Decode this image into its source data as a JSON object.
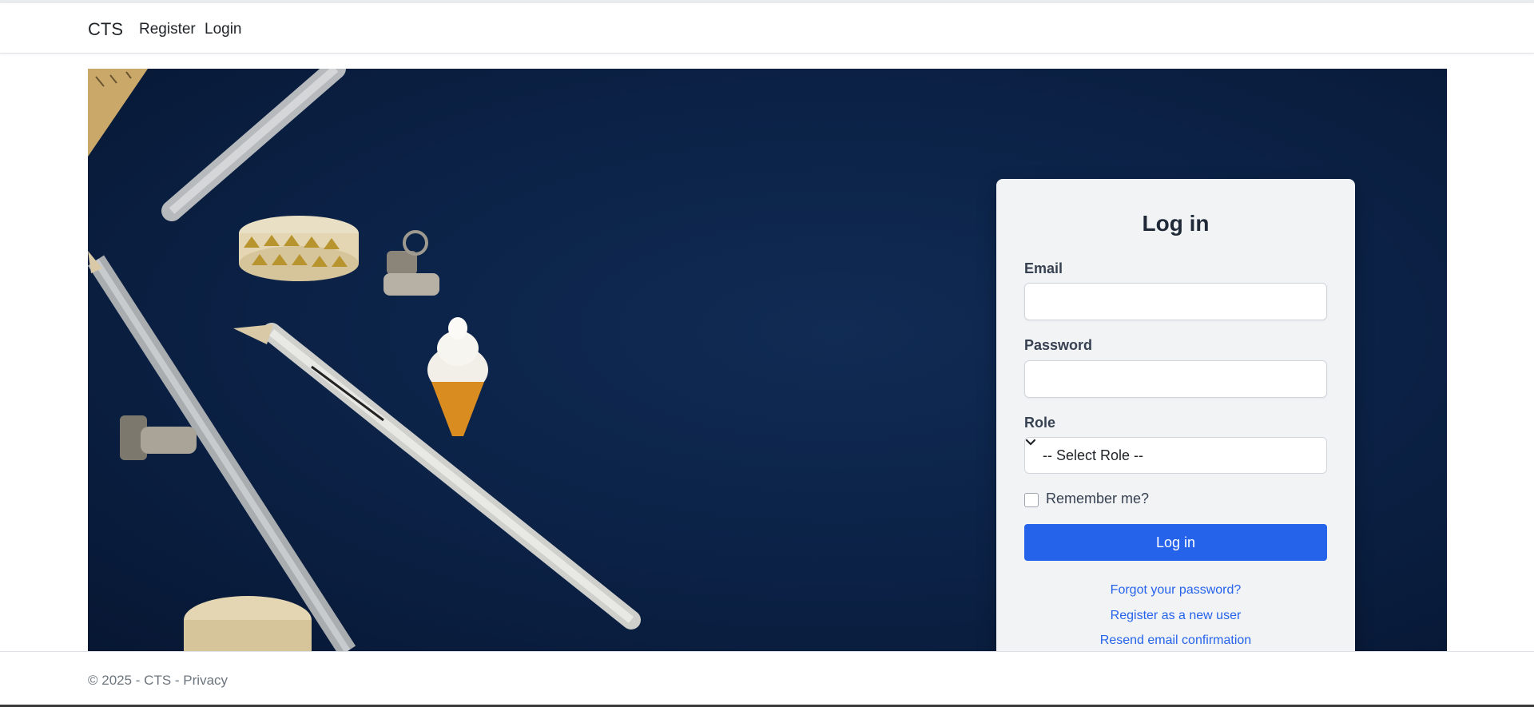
{
  "navbar": {
    "brand": "CTS",
    "links": [
      "Register",
      "Login"
    ]
  },
  "login": {
    "title": "Log in",
    "email_label": "Email",
    "email_value": "",
    "password_label": "Password",
    "password_value": "",
    "role_label": "Role",
    "role_selected": "-- Select Role --",
    "remember_label": "Remember me?",
    "remember_checked": false,
    "submit_label": "Log in",
    "links": [
      "Forgot your password?",
      "Register as a new user",
      "Resend email confirmation"
    ]
  },
  "hero": {
    "image": "dark-navy-desk-flatlay-with-pencils-tape-clips-icecream-eraser"
  },
  "footer": {
    "copyright": "© 2025 - CTS - ",
    "privacy_label": "Privacy"
  },
  "colors": {
    "primary": "#2563eb",
    "hero_background": "#0b2145",
    "card_background": "#f1f3f5"
  },
  "icons": [
    "chevron-down-icon"
  ]
}
